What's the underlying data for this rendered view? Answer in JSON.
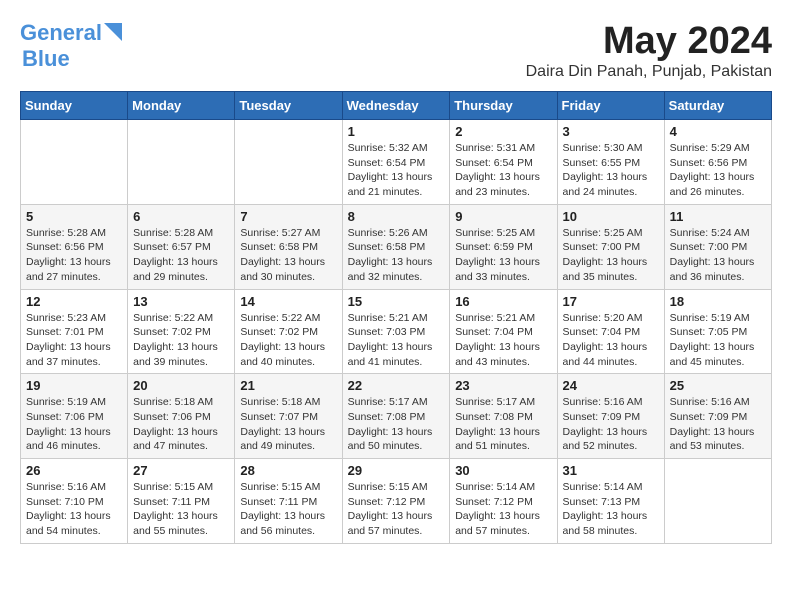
{
  "header": {
    "logo_line1": "General",
    "logo_line2": "Blue",
    "month_year": "May 2024",
    "location": "Daira Din Panah, Punjab, Pakistan"
  },
  "weekdays": [
    "Sunday",
    "Monday",
    "Tuesday",
    "Wednesday",
    "Thursday",
    "Friday",
    "Saturday"
  ],
  "weeks": [
    [
      {
        "day": "",
        "sunrise": "",
        "sunset": "",
        "daylight": ""
      },
      {
        "day": "",
        "sunrise": "",
        "sunset": "",
        "daylight": ""
      },
      {
        "day": "",
        "sunrise": "",
        "sunset": "",
        "daylight": ""
      },
      {
        "day": "1",
        "sunrise": "Sunrise: 5:32 AM",
        "sunset": "Sunset: 6:54 PM",
        "daylight": "Daylight: 13 hours and 21 minutes."
      },
      {
        "day": "2",
        "sunrise": "Sunrise: 5:31 AM",
        "sunset": "Sunset: 6:54 PM",
        "daylight": "Daylight: 13 hours and 23 minutes."
      },
      {
        "day": "3",
        "sunrise": "Sunrise: 5:30 AM",
        "sunset": "Sunset: 6:55 PM",
        "daylight": "Daylight: 13 hours and 24 minutes."
      },
      {
        "day": "4",
        "sunrise": "Sunrise: 5:29 AM",
        "sunset": "Sunset: 6:56 PM",
        "daylight": "Daylight: 13 hours and 26 minutes."
      }
    ],
    [
      {
        "day": "5",
        "sunrise": "Sunrise: 5:28 AM",
        "sunset": "Sunset: 6:56 PM",
        "daylight": "Daylight: 13 hours and 27 minutes."
      },
      {
        "day": "6",
        "sunrise": "Sunrise: 5:28 AM",
        "sunset": "Sunset: 6:57 PM",
        "daylight": "Daylight: 13 hours and 29 minutes."
      },
      {
        "day": "7",
        "sunrise": "Sunrise: 5:27 AM",
        "sunset": "Sunset: 6:58 PM",
        "daylight": "Daylight: 13 hours and 30 minutes."
      },
      {
        "day": "8",
        "sunrise": "Sunrise: 5:26 AM",
        "sunset": "Sunset: 6:58 PM",
        "daylight": "Daylight: 13 hours and 32 minutes."
      },
      {
        "day": "9",
        "sunrise": "Sunrise: 5:25 AM",
        "sunset": "Sunset: 6:59 PM",
        "daylight": "Daylight: 13 hours and 33 minutes."
      },
      {
        "day": "10",
        "sunrise": "Sunrise: 5:25 AM",
        "sunset": "Sunset: 7:00 PM",
        "daylight": "Daylight: 13 hours and 35 minutes."
      },
      {
        "day": "11",
        "sunrise": "Sunrise: 5:24 AM",
        "sunset": "Sunset: 7:00 PM",
        "daylight": "Daylight: 13 hours and 36 minutes."
      }
    ],
    [
      {
        "day": "12",
        "sunrise": "Sunrise: 5:23 AM",
        "sunset": "Sunset: 7:01 PM",
        "daylight": "Daylight: 13 hours and 37 minutes."
      },
      {
        "day": "13",
        "sunrise": "Sunrise: 5:22 AM",
        "sunset": "Sunset: 7:02 PM",
        "daylight": "Daylight: 13 hours and 39 minutes."
      },
      {
        "day": "14",
        "sunrise": "Sunrise: 5:22 AM",
        "sunset": "Sunset: 7:02 PM",
        "daylight": "Daylight: 13 hours and 40 minutes."
      },
      {
        "day": "15",
        "sunrise": "Sunrise: 5:21 AM",
        "sunset": "Sunset: 7:03 PM",
        "daylight": "Daylight: 13 hours and 41 minutes."
      },
      {
        "day": "16",
        "sunrise": "Sunrise: 5:21 AM",
        "sunset": "Sunset: 7:04 PM",
        "daylight": "Daylight: 13 hours and 43 minutes."
      },
      {
        "day": "17",
        "sunrise": "Sunrise: 5:20 AM",
        "sunset": "Sunset: 7:04 PM",
        "daylight": "Daylight: 13 hours and 44 minutes."
      },
      {
        "day": "18",
        "sunrise": "Sunrise: 5:19 AM",
        "sunset": "Sunset: 7:05 PM",
        "daylight": "Daylight: 13 hours and 45 minutes."
      }
    ],
    [
      {
        "day": "19",
        "sunrise": "Sunrise: 5:19 AM",
        "sunset": "Sunset: 7:06 PM",
        "daylight": "Daylight: 13 hours and 46 minutes."
      },
      {
        "day": "20",
        "sunrise": "Sunrise: 5:18 AM",
        "sunset": "Sunset: 7:06 PM",
        "daylight": "Daylight: 13 hours and 47 minutes."
      },
      {
        "day": "21",
        "sunrise": "Sunrise: 5:18 AM",
        "sunset": "Sunset: 7:07 PM",
        "daylight": "Daylight: 13 hours and 49 minutes."
      },
      {
        "day": "22",
        "sunrise": "Sunrise: 5:17 AM",
        "sunset": "Sunset: 7:08 PM",
        "daylight": "Daylight: 13 hours and 50 minutes."
      },
      {
        "day": "23",
        "sunrise": "Sunrise: 5:17 AM",
        "sunset": "Sunset: 7:08 PM",
        "daylight": "Daylight: 13 hours and 51 minutes."
      },
      {
        "day": "24",
        "sunrise": "Sunrise: 5:16 AM",
        "sunset": "Sunset: 7:09 PM",
        "daylight": "Daylight: 13 hours and 52 minutes."
      },
      {
        "day": "25",
        "sunrise": "Sunrise: 5:16 AM",
        "sunset": "Sunset: 7:09 PM",
        "daylight": "Daylight: 13 hours and 53 minutes."
      }
    ],
    [
      {
        "day": "26",
        "sunrise": "Sunrise: 5:16 AM",
        "sunset": "Sunset: 7:10 PM",
        "daylight": "Daylight: 13 hours and 54 minutes."
      },
      {
        "day": "27",
        "sunrise": "Sunrise: 5:15 AM",
        "sunset": "Sunset: 7:11 PM",
        "daylight": "Daylight: 13 hours and 55 minutes."
      },
      {
        "day": "28",
        "sunrise": "Sunrise: 5:15 AM",
        "sunset": "Sunset: 7:11 PM",
        "daylight": "Daylight: 13 hours and 56 minutes."
      },
      {
        "day": "29",
        "sunrise": "Sunrise: 5:15 AM",
        "sunset": "Sunset: 7:12 PM",
        "daylight": "Daylight: 13 hours and 57 minutes."
      },
      {
        "day": "30",
        "sunrise": "Sunrise: 5:14 AM",
        "sunset": "Sunset: 7:12 PM",
        "daylight": "Daylight: 13 hours and 57 minutes."
      },
      {
        "day": "31",
        "sunrise": "Sunrise: 5:14 AM",
        "sunset": "Sunset: 7:13 PM",
        "daylight": "Daylight: 13 hours and 58 minutes."
      },
      {
        "day": "",
        "sunrise": "",
        "sunset": "",
        "daylight": ""
      }
    ]
  ]
}
